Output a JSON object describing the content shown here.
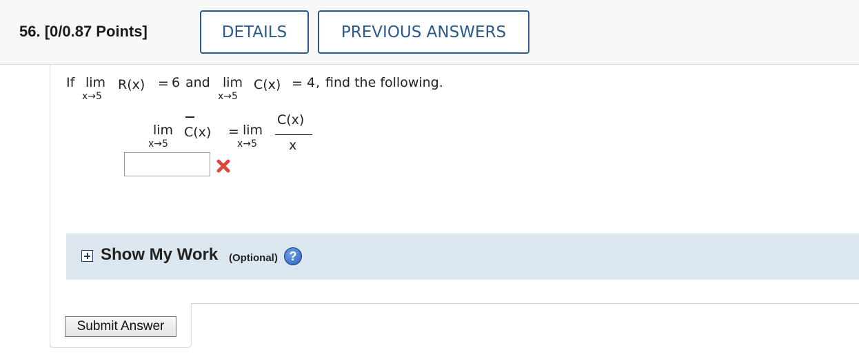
{
  "question": {
    "number_points": "56.  [0/0.87 Points]",
    "details_label": "DETAILS",
    "previous_answers_label": "PREVIOUS ANSWERS"
  },
  "problem": {
    "if": "If",
    "lim": "lim",
    "approach": "x→5",
    "r_of_x": "R(x)",
    "equals": "=",
    "r_value": "6",
    "and": "and",
    "c_of_x": "C(x)",
    "c_value": "4",
    "comma": ",",
    "find": "find the following.",
    "expr_lhs": "C(x)",
    "expr_num": "C(x)",
    "expr_den": "x"
  },
  "answer": {
    "value": "",
    "status": "incorrect",
    "status_color": "#e0473b"
  },
  "show_my_work": {
    "label": "Show My Work",
    "optional": "(Optional)",
    "help_symbol": "?"
  },
  "submit_label": "Submit Answer",
  "colors": {
    "accent": "#2a5a8c",
    "given_value": "#d42a1f",
    "work_bar": "#dce6ee"
  }
}
